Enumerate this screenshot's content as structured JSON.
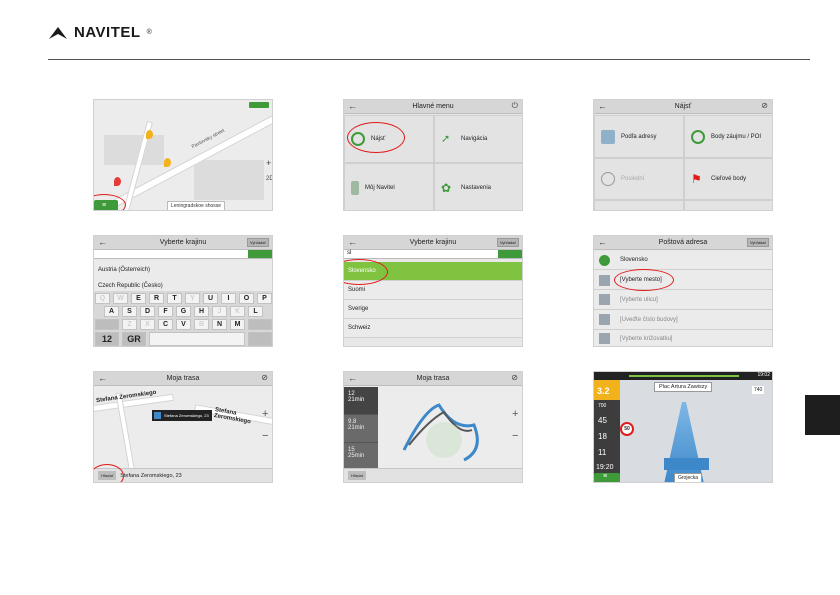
{
  "brand": {
    "name": "NAVITEL",
    "reg": "®"
  },
  "s1": {
    "street_label": "Pavlovsky street",
    "place": "Leningradskoe shosse",
    "map_scale": "2D"
  },
  "s2": {
    "title": "Hlavné menu",
    "tiles": [
      "Nájsť",
      "Navigácia",
      "Môj Navitel",
      "Nastavenia"
    ]
  },
  "s3": {
    "title": "Nájsť",
    "tiles": [
      "Podľa adresy",
      "Body záujmu / POI",
      "Poslední",
      "Cieľové body"
    ]
  },
  "s4": {
    "title": "Vyberte krajinu",
    "btn": "Vyhľadať",
    "countries": [
      "Austria (Österreich)",
      "Czech Republic (Česko)"
    ],
    "keys_row1": [
      "Q",
      "W",
      "E",
      "R",
      "T",
      "Y",
      "U",
      "I",
      "O",
      "P"
    ],
    "keys_row2": [
      "A",
      "S",
      "D",
      "F",
      "G",
      "H",
      "J",
      "K",
      "L"
    ],
    "keys_row3": [
      "Z",
      "X",
      "C",
      "V",
      "B",
      "N",
      "M"
    ],
    "key_12": "12",
    "key_gr": "GR"
  },
  "s5": {
    "title": "Vyberte krajinu",
    "btn": "Vyhľadať",
    "input": "sl",
    "countries": [
      "Slovensko",
      "Suomi",
      "Sverige",
      "Schweiz"
    ]
  },
  "s6": {
    "title": "Poštová adresa",
    "btn": "Vyhľadať",
    "rows": [
      "Slovensko",
      "[Vyberte mesto]",
      "[Vyberte ulicu]",
      "[Uveďte číslo budovy]",
      "[Vyberte križovatku]"
    ]
  },
  "s7": {
    "title": "Moja trasa",
    "street1": "Stefana Zeromskiego",
    "street2": "Stefana Zeromskiego",
    "popup": "Stefana Zeromskiego, 23",
    "bottom": "Stefana Zeromskiego, 23",
    "pill": "Hľadať"
  },
  "s8": {
    "title": "Moja trasa",
    "routes": [
      {
        "dist": "12",
        "time": "21min"
      },
      {
        "dist": "9.8",
        "time": "21min"
      },
      {
        "dist": "15",
        "time": "25min"
      }
    ],
    "pill": "Hľadať"
  },
  "s9": {
    "street": "Plac Artura Zawiszy",
    "dist_big": "3.2",
    "dist_small": "700",
    "speed_limit": "50",
    "speed": "45",
    "time1": "18",
    "time2": "11",
    "clock": "19:20",
    "next": "Grojecka",
    "time_top": "19:02",
    "count": "740"
  }
}
